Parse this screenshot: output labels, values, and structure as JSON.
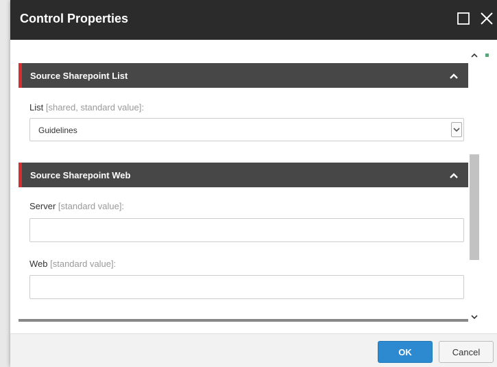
{
  "window": {
    "title": "Control Properties",
    "maximize_icon": "maximize-icon",
    "close_icon": "close-icon"
  },
  "sections": [
    {
      "title": "Source Sharepoint List",
      "icon": "chevron-up-icon",
      "fields": [
        {
          "label": "List",
          "hint": "[shared, standard value]:",
          "type": "select",
          "value": "Guidelines"
        }
      ]
    },
    {
      "title": "Source Sharepoint Web",
      "icon": "chevron-up-icon",
      "fields": [
        {
          "label": "Server",
          "hint": "[standard value]:",
          "type": "text",
          "value": ""
        },
        {
          "label": "Web",
          "hint": "[standard value]:",
          "type": "text",
          "value": ""
        }
      ]
    }
  ],
  "footer": {
    "ok_label": "OK",
    "cancel_label": "Cancel"
  },
  "colors": {
    "titlebar": "#2b2b2b",
    "section_header": "#474747",
    "section_accent": "#d32f2f",
    "ok_button": "#2d8ad1"
  }
}
